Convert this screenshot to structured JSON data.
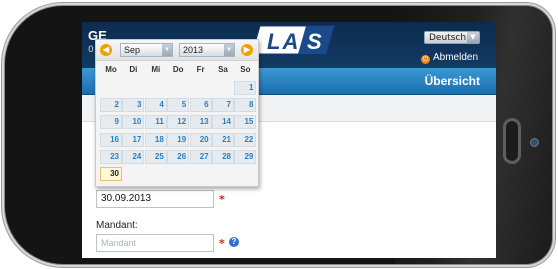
{
  "app": {
    "title": "GE",
    "subtitle": "0",
    "language": "Deutsch",
    "logout_label": "Abmelden",
    "nav_title": "Übersicht",
    "logo_text": "LAS"
  },
  "datepicker": {
    "month": "Sep",
    "year": "2013",
    "weekdays": [
      "Mo",
      "Di",
      "Mi",
      "Do",
      "Fr",
      "Sa",
      "So"
    ],
    "days": [
      [
        "",
        "",
        "",
        "",
        "",
        "",
        "1"
      ],
      [
        "2",
        "3",
        "4",
        "5",
        "6",
        "7",
        "8"
      ],
      [
        "9",
        "10",
        "11",
        "12",
        "13",
        "14",
        "15"
      ],
      [
        "16",
        "17",
        "18",
        "19",
        "20",
        "21",
        "22"
      ],
      [
        "23",
        "24",
        "25",
        "26",
        "27",
        "28",
        "29"
      ],
      [
        "30",
        "",
        "",
        "",
        "",
        "",
        ""
      ]
    ],
    "selected_day": "30"
  },
  "form": {
    "date_value": "30.09.2013",
    "required_marker": "*",
    "mandant_label": "Mandant:",
    "mandant_placeholder": "Mandant",
    "help_icon": "?"
  },
  "colors": {
    "header_bg": "#0c2c4e",
    "nav_bg": "#2584c8",
    "accent_orange": "#f0a000",
    "required_red": "#d2231f",
    "day_text": "#2a7fc0"
  }
}
